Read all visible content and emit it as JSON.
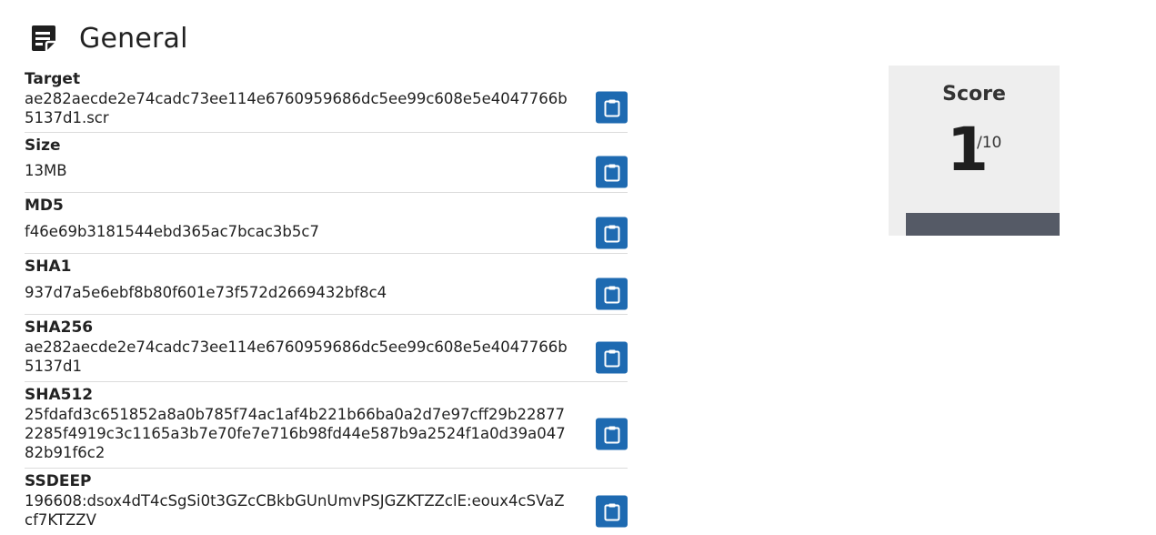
{
  "section": {
    "title": "General"
  },
  "fields": [
    {
      "label": "Target",
      "value": "ae282aecde2e74cadc73ee114e6760959686dc5ee99c608e5e4047766b5137d1.scr"
    },
    {
      "label": "Size",
      "value": "13MB"
    },
    {
      "label": "MD5",
      "value": "f46e69b3181544ebd365ac7bcac3b5c7"
    },
    {
      "label": "SHA1",
      "value": "937d7a5e6ebf8b80f601e73f572d2669432bf8c4"
    },
    {
      "label": "SHA256",
      "value": "ae282aecde2e74cadc73ee114e6760959686dc5ee99c608e5e4047766b5137d1"
    },
    {
      "label": "SHA512",
      "value": "25fdafd3c651852a8a0b785f74ac1af4b221b66ba0a2d7e97cff29b228772285f4919c3c1165a3b7e70fe7e716b98fd44e587b9a2524f1a0d39a04782b91f6c2"
    },
    {
      "label": "SSDEEP",
      "value": "196608:dsox4dT4cSgSi0t3GZcCBkbGUnUmvPSJGZKTZZclE:eoux4cSVaZcf7KTZZV"
    }
  ],
  "score": {
    "title": "Score",
    "value": "1",
    "max": "/10"
  },
  "colors": {
    "button": "#1e6ab1",
    "bar": "#555a66",
    "card": "#eeeeee"
  },
  "icons": {
    "header": "note-icon",
    "copy": "clipboard-icon"
  }
}
